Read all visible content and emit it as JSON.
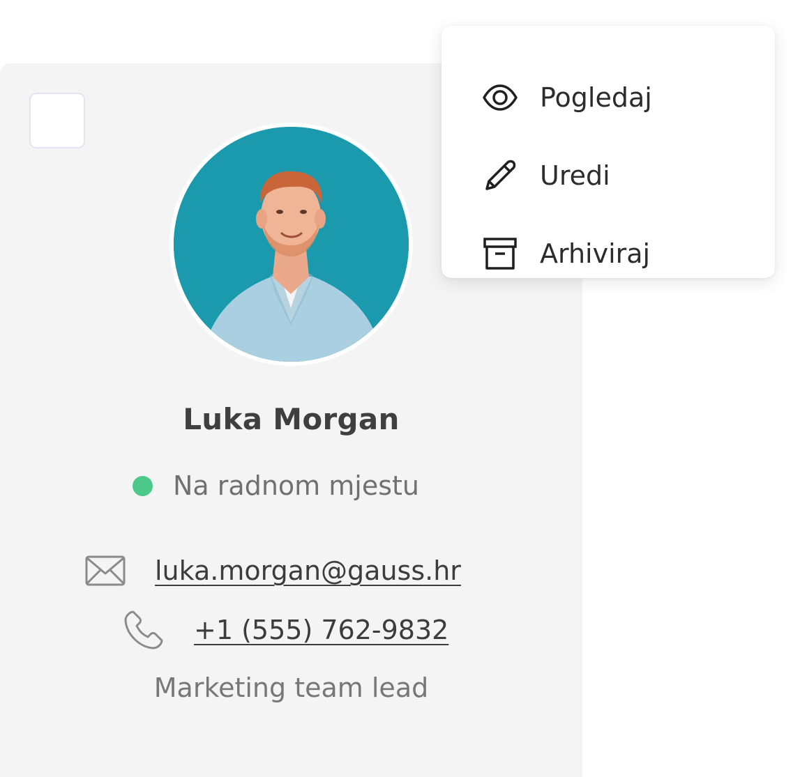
{
  "colors": {
    "card_background": "#f4f4f4",
    "avatar_background": "#1b9aae",
    "status_online": "#4cc98a",
    "menu_background": "#ffffff"
  },
  "contact_card": {
    "name": "Luka Morgan",
    "status": "Na radnom mjestu",
    "email": "luka.morgan@gauss.hr",
    "phone": "+1 (555) 762-9832",
    "role": "Marketing team lead",
    "icons": {
      "email": "envelope-icon",
      "phone": "phone-icon"
    }
  },
  "context_menu": {
    "items": [
      {
        "label": "Pogledaj",
        "icon": "eye-icon"
      },
      {
        "label": "Uredi",
        "icon": "pencil-icon"
      },
      {
        "label": "Arhiviraj",
        "icon": "archive-icon"
      }
    ]
  }
}
